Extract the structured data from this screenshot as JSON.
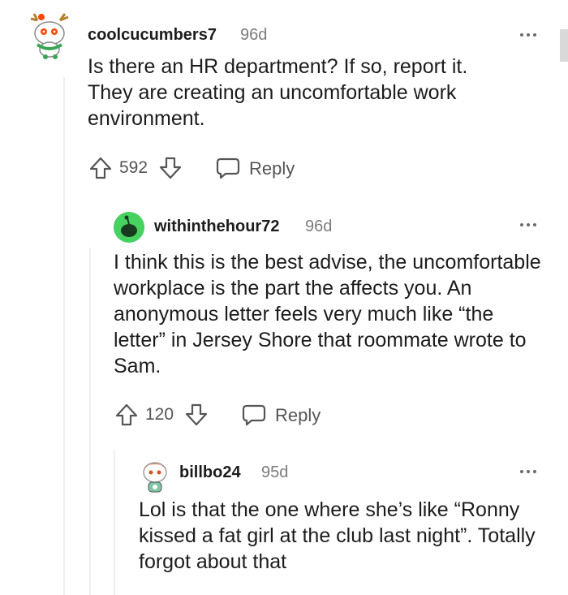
{
  "comments": [
    {
      "username": "coolcucumbers7",
      "age": "96d",
      "text": "Is there an HR department? If so, report it. They are creating an uncomfortable work environment.",
      "score": "592",
      "reply_label": "Reply",
      "avatar_colors": {
        "bg": "#ffffff",
        "accent": "#c9a227"
      }
    },
    {
      "username": "withinthehour72",
      "age": "96d",
      "text": "I think this is the best advise, the uncomfortable workplace is the part the affects you. An anonymous letter feels very much like “the letter” in Jersey Shore that roommate wrote to Sam.",
      "score": "120",
      "reply_label": "Reply",
      "avatar_colors": {
        "bg": "#46d160",
        "accent": "#1a3a1f"
      }
    },
    {
      "username": "billbo24",
      "age": "95d",
      "text": "Lol is that the one where she’s like “Ronny kissed a fat girl at the club last night”. Totally forgot about that",
      "avatar_colors": {
        "bg": "#ffffff",
        "accent": "#d9541e"
      }
    }
  ],
  "icons": {
    "upvote": "upvote-icon",
    "downvote": "downvote-icon",
    "reply": "comment-bubble-icon",
    "more": "more-options-icon"
  },
  "colors": {
    "text": "#1c1c1c",
    "meta": "#7c7c7c",
    "thread_line": "#edeff1",
    "green_avatar": "#46d160"
  }
}
